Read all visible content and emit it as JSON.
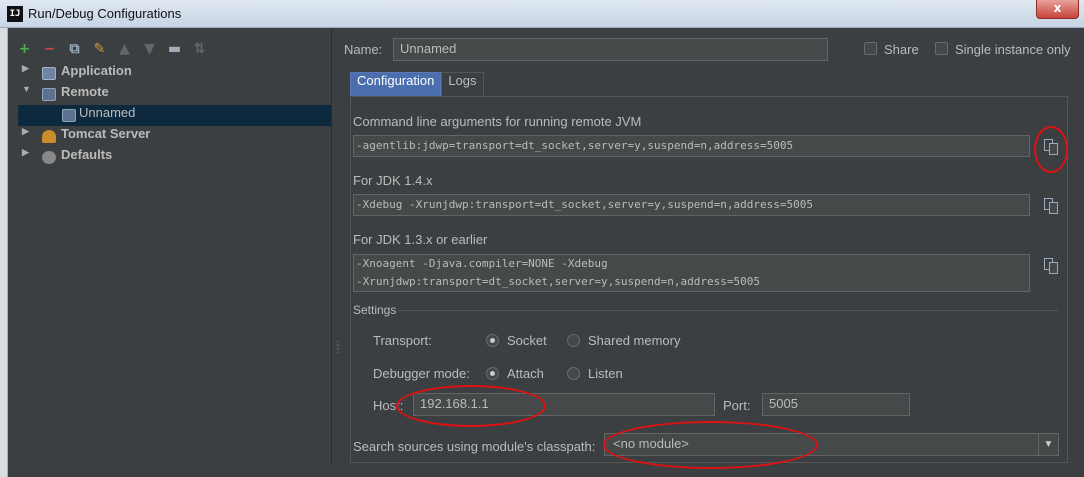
{
  "window": {
    "title": "Run/Debug Configurations",
    "app_icon": "IJ",
    "close": "x"
  },
  "toolbar": [
    "add-icon",
    "remove-icon",
    "copy-icon",
    "wrench-icon",
    "up-icon",
    "down-icon",
    "folder-icon",
    "sort-icon"
  ],
  "tree": [
    {
      "label": "Application",
      "icon": "application-icon",
      "expanded": false
    },
    {
      "label": "Remote",
      "icon": "remote-icon",
      "expanded": true
    },
    {
      "label": "Unnamed",
      "icon": "remote-config-icon",
      "child": true,
      "selected": true
    },
    {
      "label": "Tomcat Server",
      "icon": "tomcat-icon",
      "expanded": false
    },
    {
      "label": "Defaults",
      "icon": "defaults-icon",
      "expanded": false
    }
  ],
  "form": {
    "name_label": "Name:",
    "name_value": "Unnamed",
    "share_label": "Share",
    "single_instance_label": "Single instance only",
    "tabs": [
      "Configuration",
      "Logs"
    ],
    "cmd_label": "Command line arguments for running remote JVM",
    "cmd_value": "-agentlib:jdwp=transport=dt_socket,server=y,suspend=n,address=5005",
    "jdk14_label": "For JDK 1.4.x",
    "jdk14_value": "-Xdebug -Xrunjdwp:transport=dt_socket,server=y,suspend=n,address=5005",
    "jdk13_label": "For JDK 1.3.x or earlier",
    "jdk13_line1": "-Xnoagent -Djava.compiler=NONE -Xdebug",
    "jdk13_line2": "-Xrunjdwp:transport=dt_socket,server=y,suspend=n,address=5005",
    "settings_label": "Settings",
    "transport_label": "Transport:",
    "transport_socket": "Socket",
    "transport_shared": "Shared memory",
    "debugger_label": "Debugger mode:",
    "debugger_attach": "Attach",
    "debugger_listen": "Listen",
    "host_label": "Host:",
    "host_value": "192.168.1.1",
    "port_label": "Port:",
    "port_value": "5005",
    "module_label": "Search sources using module's classpath:",
    "module_value": "<no module>"
  },
  "colors": {
    "background": "#3c3f41",
    "field": "#45494a",
    "accent": "#4b6eaf",
    "selection": "#0d293e",
    "annotation": "#dd1111"
  }
}
